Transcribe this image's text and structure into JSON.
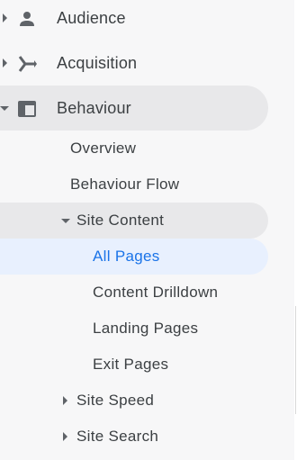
{
  "nav": {
    "audience_label": "Audience",
    "acquisition_label": "Acquisition",
    "behaviour_label": "Behaviour",
    "behaviour": {
      "overview_label": "Overview",
      "behaviour_flow_label": "Behaviour Flow",
      "site_content_label": "Site Content",
      "site_content": {
        "all_pages_label": "All Pages",
        "content_drilldown_label": "Content Drilldown",
        "landing_pages_label": "Landing Pages",
        "exit_pages_label": "Exit Pages"
      },
      "site_speed_label": "Site Speed",
      "site_search_label": "Site Search"
    }
  },
  "colors": {
    "active_text": "#1a73e8",
    "active_bg": "#e8f0fe",
    "group_bg": "#e8e8ea",
    "text": "#3c4043",
    "icon": "#5f6368"
  },
  "icons": {
    "audience": "person-icon",
    "acquisition": "fork-icon",
    "behaviour": "window-icon"
  }
}
